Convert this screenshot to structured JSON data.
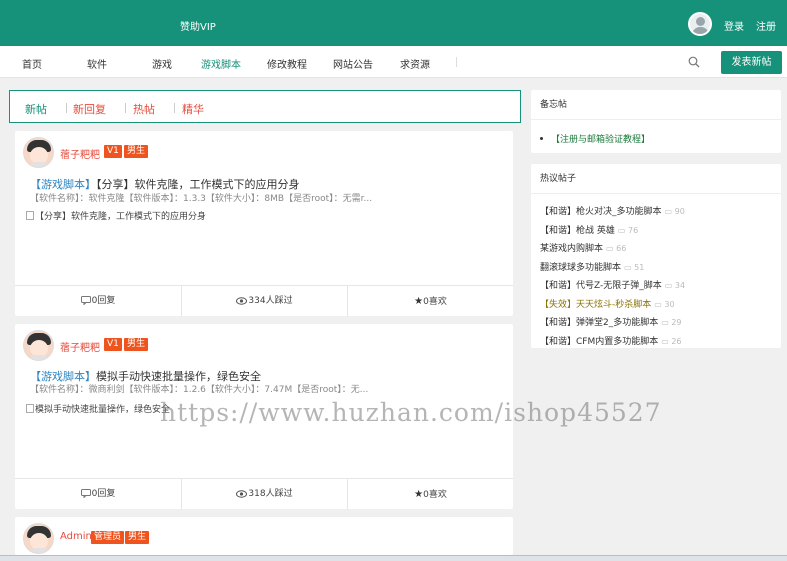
{
  "topbar": {
    "vip": "赞助VIP",
    "login": "登录",
    "register": "注册"
  },
  "nav": {
    "items": [
      "首页",
      "软件",
      "游戏",
      "游戏脚本",
      "修改教程",
      "网站公告",
      "求资源"
    ],
    "active_index": 3,
    "publish": "发表新帖"
  },
  "filters": [
    "新帖",
    "新回复",
    "热帖",
    "精华"
  ],
  "posts": [
    {
      "user": "蓿子粑粑",
      "level": "V1",
      "gender": "男生",
      "tag": "【游戏脚本】",
      "title": "【分享】软件克隆，工作模式下的应用分身",
      "meta": "【软件名称】：软件克隆【软件版本】：1.3.3【软件大小】：8MB【是否root】：无需r...",
      "image_alt": "【分享】软件克隆，工作模式下的应用分身",
      "replies": "0回复",
      "views": "334人踩过",
      "likes": "0喜欢"
    },
    {
      "user": "蓿子粑粑",
      "level": "V1",
      "gender": "男生",
      "tag": "【游戏脚本】",
      "title": "模拟手动快速批量操作，绿色安全",
      "meta": "【软件名称】：微商利剑【软件版本】：1.2.6【软件大小】：7.47M【是否root】：无...",
      "image_alt": "模拟手动快速批量操作，绿色安全",
      "replies": "0回复",
      "views": "318人踩过",
      "likes": "0喜欢"
    },
    {
      "user": "Admin",
      "role": "管理员",
      "gender": "男生"
    }
  ],
  "sidebar": {
    "memo_title": "备忘帖",
    "memo_item": "【注册与邮箱验证教程】",
    "hot_title": "热议帖子",
    "hot_items": [
      {
        "text": "【和谐】枪火对决_多功能脚本",
        "count": "90",
        "failed": false
      },
      {
        "text": "【和谐】枪战 英雄",
        "count": "76",
        "failed": false
      },
      {
        "text": "某游戏内购脚本",
        "count": "66",
        "failed": false
      },
      {
        "text": "翻滚球球多功能脚本",
        "count": "51",
        "failed": false
      },
      {
        "text": "【和谐】代号Z-无限子弹_脚本",
        "count": "34",
        "failed": false
      },
      {
        "text": "【失效】天天炫斗-秒杀脚本",
        "count": "30",
        "failed": true
      },
      {
        "text": "【和谐】弹弹堂2_多功能脚本",
        "count": "29",
        "failed": false
      },
      {
        "text": "【和谐】CFM内置多功能脚本",
        "count": "26",
        "failed": false
      }
    ]
  },
  "watermark": "https://www.huzhan.com/ishop45527",
  "colors": {
    "brand": "#16917a",
    "accent": "#e74c3c",
    "badge": "#f0541e",
    "tag": "#2e86c1"
  }
}
